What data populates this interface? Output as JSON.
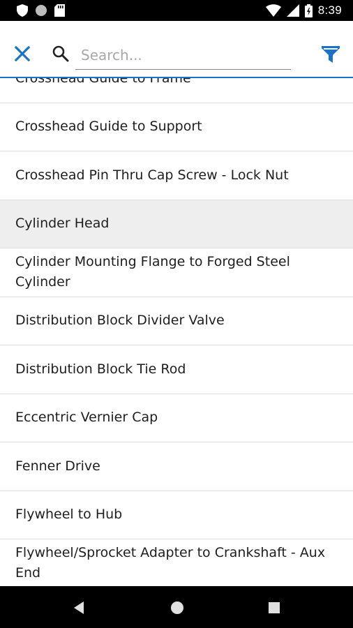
{
  "status_bar": {
    "time": "8:39",
    "icons": [
      "shield-icon",
      "circle-icon",
      "sd-card-icon",
      "wifi-icon",
      "cell-signal-icon",
      "battery-icon"
    ]
  },
  "toolbar": {
    "close_icon": "close-icon",
    "search_icon": "search-icon",
    "search_placeholder": "Search...",
    "search_value": "",
    "filter_icon": "filter-icon"
  },
  "colors": {
    "accent": "#1a73c8",
    "selected_row": "#eeeeee",
    "divider": "#dcdcdc"
  },
  "list": {
    "items": [
      {
        "label": "Crosshead Guide to Frame",
        "selected": false
      },
      {
        "label": "Crosshead Guide to Support",
        "selected": false
      },
      {
        "label": "Crosshead Pin Thru Cap Screw - Lock Nut",
        "selected": false
      },
      {
        "label": "Cylinder Head",
        "selected": true
      },
      {
        "label": "Cylinder Mounting Flange to Forged Steel Cylinder",
        "selected": false
      },
      {
        "label": "Distribution Block Divider Valve",
        "selected": false
      },
      {
        "label": "Distribution Block Tie Rod",
        "selected": false
      },
      {
        "label": "Eccentric Vernier Cap",
        "selected": false
      },
      {
        "label": "Fenner Drive",
        "selected": false
      },
      {
        "label": "Flywheel to Hub",
        "selected": false
      },
      {
        "label": "Flywheel/Sprocket Adapter to Crankshaft - Aux End",
        "selected": false
      }
    ]
  },
  "nav_bar": {
    "icons": [
      "back-icon",
      "home-icon",
      "recents-icon"
    ]
  }
}
